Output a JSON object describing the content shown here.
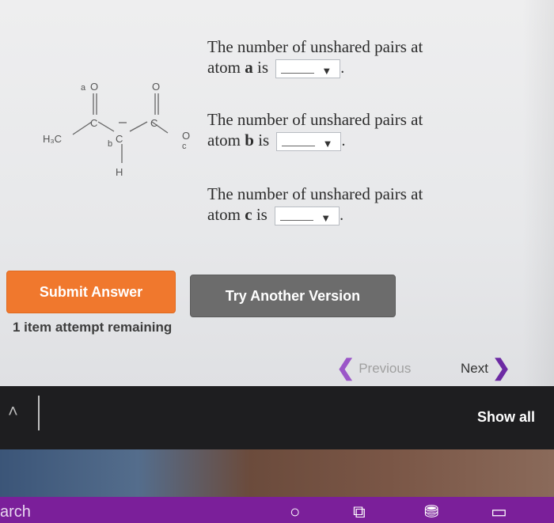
{
  "questions": [
    {
      "line1": "The number of unshared pairs at",
      "prefix": "atom ",
      "atom": "a",
      "suffix": " is",
      "select_value": "",
      "period": "."
    },
    {
      "line1": "The number of unshared pairs at",
      "prefix": "atom ",
      "atom": "b",
      "suffix": " is",
      "select_value": "",
      "period": "."
    },
    {
      "line1": "The number of unshared pairs at",
      "prefix": "atom ",
      "atom": "c",
      "suffix": " is",
      "select_value": "",
      "period": "."
    }
  ],
  "molecule": {
    "h3c": "H₃C",
    "c1": "C",
    "c2": "C",
    "c3": "C",
    "o1": "O",
    "o2": "O",
    "o3": "O",
    "h": "H",
    "label_a": "a",
    "label_b": "b",
    "label_c": "c"
  },
  "buttons": {
    "submit": "Submit Answer",
    "try_another": "Try Another Version"
  },
  "attempts_text": "1 item attempt remaining",
  "nav": {
    "previous": "Previous",
    "next": "Next"
  },
  "download_bar": {
    "show_all": "Show all"
  },
  "taskbar": {
    "search": "arch"
  },
  "colors": {
    "submit": "#f0782d",
    "try_another": "#6c6c6c",
    "nav_chevron": "#6c2aa3",
    "taskbar": "#7b1f9a"
  }
}
